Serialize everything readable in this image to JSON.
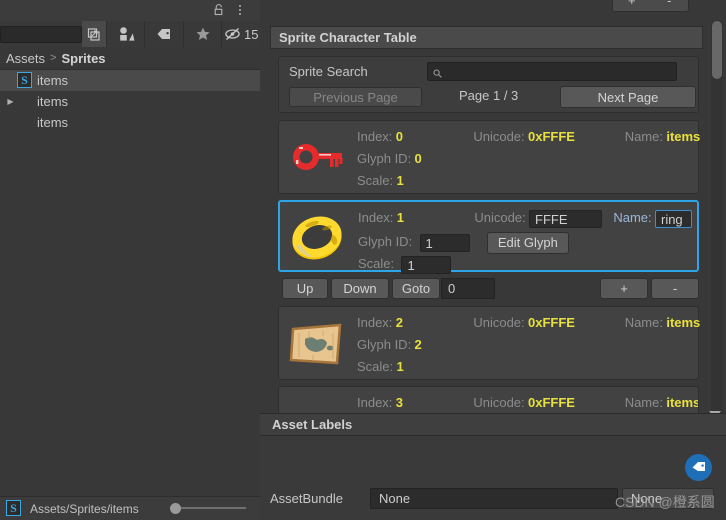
{
  "project_panel": {
    "title_icons": {
      "lock": "lock-icon",
      "menu": "kebab-menu-icon"
    },
    "toolbar": {
      "search_placeholder": "",
      "search_value": "",
      "hidden_count": "15",
      "icons": [
        "two-column-layout-icon",
        "filter-by-type-icon",
        "filter-by-label-icon",
        "favorites-star-icon",
        "hidden-eye-icon"
      ]
    },
    "breadcrumb": {
      "root": "Assets",
      "separator": ">",
      "current": "Sprites"
    },
    "tree": [
      {
        "label": "items",
        "icon": "sprite-asset-icon",
        "expandable": false,
        "selected": true
      },
      {
        "label": "items",
        "icon": "texture-thumbnail-icon",
        "expandable": true,
        "selected": false
      },
      {
        "label": "items",
        "icon": "file-asset-icon",
        "expandable": false,
        "selected": false
      }
    ],
    "status": {
      "icon": "sprite-asset-icon",
      "path": "Assets/Sprites/items"
    }
  },
  "inspector": {
    "top_buttons": {
      "add": "+",
      "remove": "-"
    },
    "section_title": "Sprite Character Table",
    "search": {
      "label": "Sprite Search",
      "value": "",
      "placeholder": "",
      "icon": "search-icon"
    },
    "pagination": {
      "previous_label": "Previous Page",
      "previous_disabled": true,
      "page_text": "Page 1 / 3",
      "current_page": 1,
      "total_pages": 3,
      "next_label": "Next Page"
    },
    "field_labels": {
      "index": "Index:",
      "unicode": "Unicode:",
      "name": "Name:",
      "glyph_id": "Glyph ID:",
      "scale": "Scale:",
      "edit_glyph": "Edit Glyph"
    },
    "rows": [
      {
        "index": "0",
        "unicode": "0xFFFE",
        "name": "items",
        "glyph_id": "0",
        "scale": "1",
        "thumbnail": "red-key-sprite",
        "selected": false
      },
      {
        "index": "1",
        "unicode": "FFFE",
        "name": "ring",
        "glyph_id": "1",
        "scale": "1",
        "thumbnail": "gold-ring-sprite",
        "selected": true
      },
      {
        "index": "2",
        "unicode": "0xFFFE",
        "name": "items",
        "glyph_id": "2",
        "scale": "1",
        "thumbnail": "treasure-map-sprite",
        "selected": false
      },
      {
        "index": "3",
        "unicode": "0xFFFE",
        "name": "items",
        "glyph_id": "",
        "scale": "",
        "thumbnail": "partial-sprite",
        "selected": false
      }
    ],
    "row_toolbar": {
      "up": "Up",
      "down": "Down",
      "goto": "Goto",
      "goto_value": "0",
      "add": "+",
      "remove": "-"
    }
  },
  "asset_labels": {
    "title": "Asset Labels",
    "tag_button_icon": "label-tag-icon",
    "assetbundle_label": "AssetBundle",
    "assetbundle_value": "None",
    "assetbundle_variant": "None"
  },
  "watermark": {
    "text": "CSDN @橙系圆"
  },
  "colors": {
    "background": "#383838",
    "panel": "#424242",
    "selection_blue": "#2ea5e8",
    "value_yellow": "#e8e03c",
    "label_gray": "#8c8c8c",
    "button": "#585858",
    "tag_blue": "#1e6fb8"
  }
}
